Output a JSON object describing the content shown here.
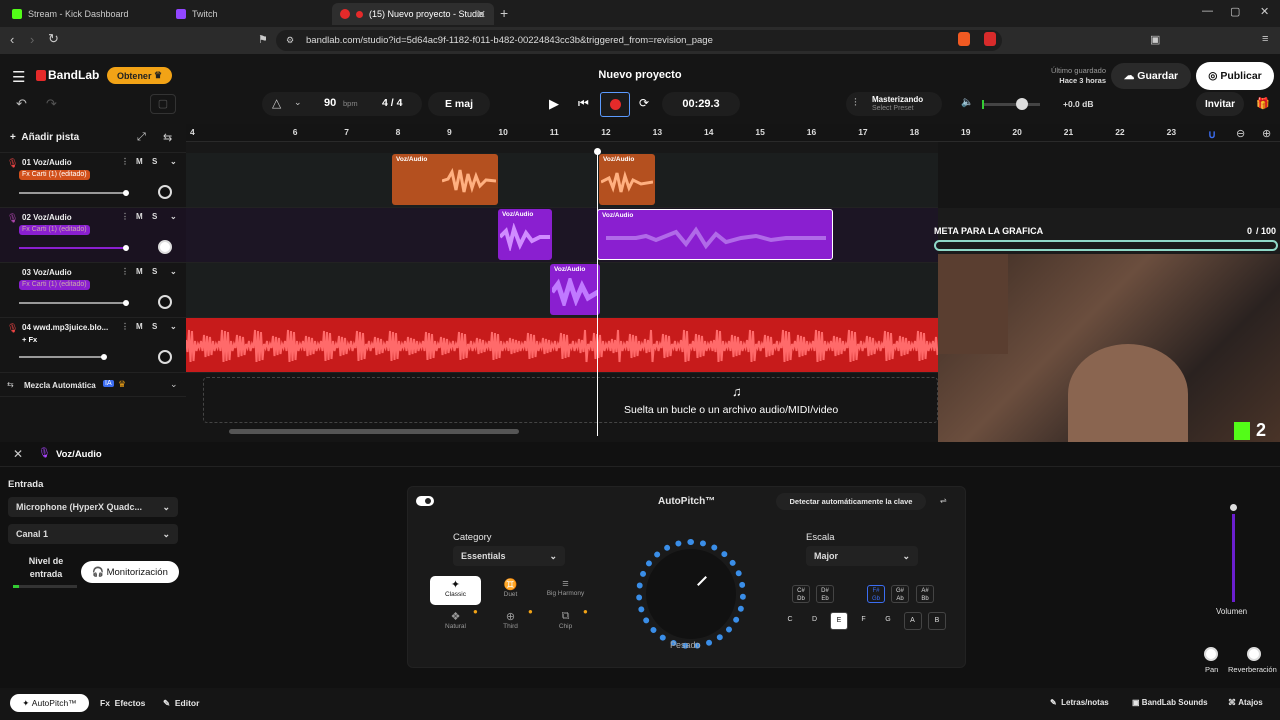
{
  "browser": {
    "tabs": [
      {
        "label": "Stream - Kick Dashboard"
      },
      {
        "label": "Twitch"
      },
      {
        "label": "(15) Nuevo proyecto - Studio"
      }
    ],
    "url": "bandlab.com/studio?id=5d64ac9f-1182-f011-b482-00224843cc3b&triggered_from=revision_page"
  },
  "header": {
    "logo": "BandLab",
    "obtener": "Obtener",
    "project_title": "Nuevo proyecto",
    "last_saved_label": "Último guardado",
    "last_saved_time": "Hace 3 horas",
    "save": "Guardar",
    "publish": "Publicar",
    "invite": "Invitar"
  },
  "transport": {
    "bpm": "90",
    "bpm_unit": "bpm",
    "time_signature": "4 / 4",
    "key": "E maj",
    "time": "00:29.3",
    "mastering": "Masterizando",
    "mastering_preset": "Select Preset",
    "gain": "+0.0 dB"
  },
  "tracks_header": {
    "add_track": "Añadir pista"
  },
  "ruler": [
    "4",
    "",
    "6",
    "7",
    "8",
    "9",
    "10",
    "11",
    "12",
    "13",
    "14",
    "15",
    "16",
    "17",
    "18",
    "19",
    "20",
    "21",
    "22",
    "23"
  ],
  "tracks": [
    {
      "name": "01  Voz/Audio",
      "fx": "Fx Carti (1) (editado)",
      "fx_color": "#d2501b",
      "clips": [
        "Voz/Audio",
        "Voz/Audio"
      ]
    },
    {
      "name": "02  Voz/Audio",
      "fx": "Fx Carti (1) (editado)",
      "fx_color": "#8a1fd0",
      "clips": [
        "Voz/Audio",
        "Voz/Audio"
      ]
    },
    {
      "name": "03  Voz/Audio",
      "fx": "Fx Carti (1) (editado)",
      "fx_color": "#8a1fd0",
      "clips": [
        "Voz/Audio"
      ]
    },
    {
      "name": "04  wwd.mp3juice.blo...",
      "fx": "+ Fx",
      "fx_color": "",
      "clips": []
    }
  ],
  "track_controls": {
    "m": "M",
    "s": "S"
  },
  "automix": {
    "label": "Mezcla Automática",
    "badge": "IA"
  },
  "drop_zone": "Suelta un bucle o un archivo audio/MIDI/video",
  "overlay": {
    "goal_label": "META PARA LA GRAFICA",
    "goal_value": "0",
    "goal_total": "/ 100",
    "kick_count": "2"
  },
  "editor": {
    "title": "Voz/Audio",
    "input_label": "Entrada",
    "input_device": "Microphone (HyperX Quadc...",
    "channel": "Canal 1",
    "level_label": "Nivel de entrada",
    "monitor": "Monitorización"
  },
  "autopitch": {
    "title": "AutoPitch™",
    "detect": "Detectar automáticamente la clave",
    "category_label": "Category",
    "category_value": "Essentials",
    "presets": [
      "Classic",
      "Duet",
      "Big Harmony",
      "Natural",
      "Third",
      "Chip"
    ],
    "knob_label": "Pesado",
    "scale_label": "Escala",
    "scale_value": "Major",
    "sharp_keys": [
      "C#\nDb",
      "D#\nEb",
      "F#\nGb",
      "G#\nAb",
      "A#\nBb"
    ],
    "keys": [
      "C",
      "D",
      "E",
      "F",
      "G",
      "A",
      "B"
    ]
  },
  "right_panel": {
    "volume": "Volumen",
    "pan": "Pan",
    "reverb": "Reverberación"
  },
  "bottom": {
    "autopitch": "AutoPitch™",
    "effects": "Efectos",
    "editor": "Editor",
    "lyrics": "Letras/notas",
    "sounds": "BandLab Sounds",
    "shortcuts": "Atajos"
  },
  "colors": {
    "accent": "#f2a316",
    "record": "#e52a2a",
    "track1": "#d2501b",
    "track2": "#8a1fd0",
    "track4": "#d01d1d",
    "kick": "#53fc18"
  }
}
